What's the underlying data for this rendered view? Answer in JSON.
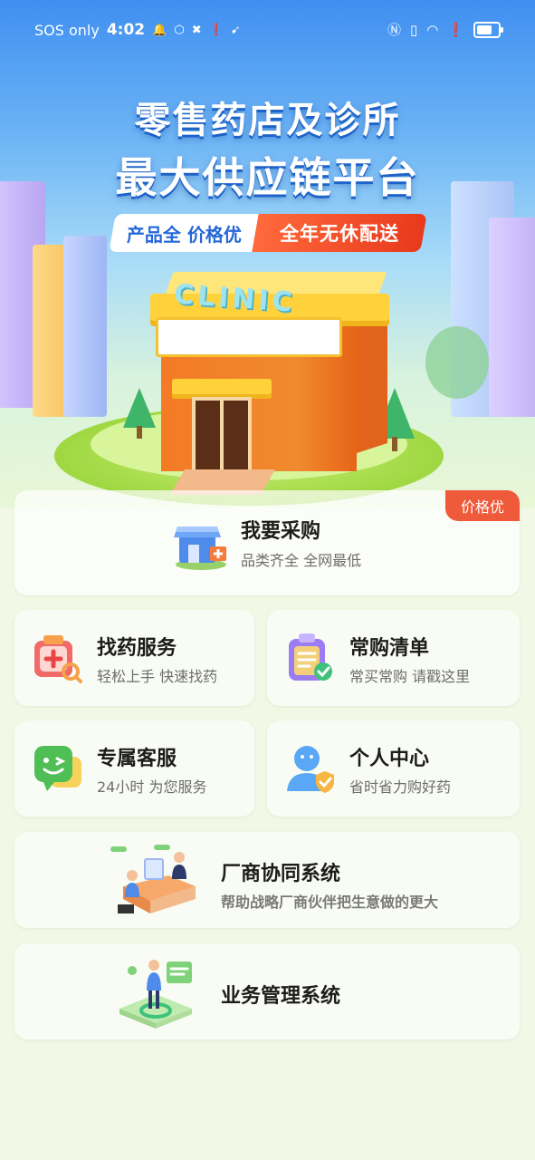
{
  "status_bar": {
    "carrier": "SOS only",
    "time": "4:02",
    "icons_left": [
      "bell-icon",
      "shield-icon",
      "vpn-icon",
      "alert-icon",
      "bird-icon"
    ],
    "icons_right": [
      "nfc-icon",
      "vibrate-icon",
      "wifi-icon",
      "alert-icon",
      "battery-icon"
    ]
  },
  "hero": {
    "title_line1": "零售药店及诊所",
    "title_line2": "最大供应链平台",
    "tag_left": "产品全 价格优",
    "tag_right": "全年无休配送",
    "clinic_sign": "CLINIC"
  },
  "purchase_card": {
    "badge": "价格优",
    "title": "我要采购",
    "subtitle": "品类齐全 全网最低"
  },
  "grid": [
    {
      "title": "找药服务",
      "subtitle": "轻松上手 快速找药",
      "icon": "medicine-search-icon"
    },
    {
      "title": "常购清单",
      "subtitle": "常买常购 请戳这里",
      "icon": "checklist-icon"
    },
    {
      "title": "专属客服",
      "subtitle": "24小时 为您服务",
      "icon": "chat-icon"
    },
    {
      "title": "个人中心",
      "subtitle": "省时省力购好药",
      "icon": "user-icon"
    }
  ],
  "manufacturer_card": {
    "title": "厂商协同系统",
    "subtitle": "帮助战略厂商伙伴把生意做的更大"
  },
  "business_card": {
    "title": "业务管理系统"
  },
  "colors": {
    "accent_red": "#ef5a3a",
    "brand_blue": "#2567d8",
    "background": "#f1f8e6"
  }
}
